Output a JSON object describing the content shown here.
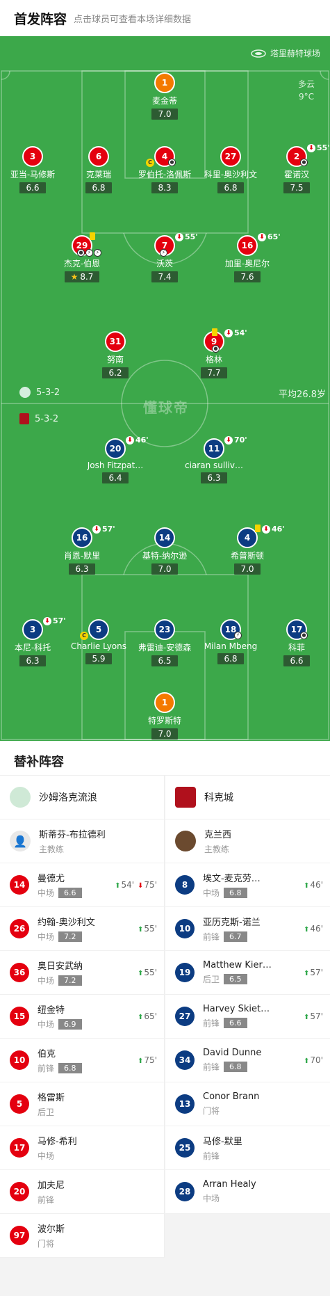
{
  "header": {
    "title": "首发阵容",
    "subtitle": "点击球员可查看本场详细数据"
  },
  "pitch": {
    "venue": "塔里赫特球场",
    "weather": "多云",
    "temperature": "9°C",
    "home_formation": "5-3-2",
    "away_formation": "5-3-2",
    "avg_age": "平均26.8岁",
    "watermark": "懂球帝"
  },
  "home_players": [
    {
      "num": "1",
      "name": "麦金蒂",
      "rating": "7.0",
      "color": "org"
    },
    {
      "num": "3",
      "name": "亚当-马修斯",
      "rating": "6.6",
      "color": "red"
    },
    {
      "num": "6",
      "name": "克莱瑞",
      "rating": "6.8",
      "color": "red"
    },
    {
      "num": "4",
      "name": "罗伯托-洛佩斯",
      "rating": "8.3",
      "color": "red"
    },
    {
      "num": "27",
      "name": "科里-奥沙利文",
      "rating": "6.8",
      "color": "red"
    },
    {
      "num": "2",
      "name": "霍诺汉",
      "rating": "7.5",
      "color": "red",
      "sub": "55'"
    },
    {
      "num": "29",
      "name": "杰克-伯恩",
      "rating": "8.7",
      "color": "red"
    },
    {
      "num": "7",
      "name": "沃茨",
      "rating": "7.4",
      "color": "red",
      "sub": "55'"
    },
    {
      "num": "16",
      "name": "加里-奥尼尔",
      "rating": "7.6",
      "color": "red",
      "sub": "65'"
    },
    {
      "num": "31",
      "name": "努南",
      "rating": "6.2",
      "color": "red"
    },
    {
      "num": "9",
      "name": "格林",
      "rating": "7.7",
      "color": "red",
      "sub": "54'"
    }
  ],
  "away_players": [
    {
      "num": "20",
      "name": "Josh Fitzpat…",
      "rating": "6.4",
      "color": "blue",
      "sub": "46'"
    },
    {
      "num": "11",
      "name": "ciaran sulliv…",
      "rating": "6.3",
      "color": "blue",
      "sub": "70'"
    },
    {
      "num": "16",
      "name": "肖恩-默里",
      "rating": "6.3",
      "color": "blue",
      "sub": "57'"
    },
    {
      "num": "14",
      "name": "基特-纳尔逊",
      "rating": "7.0",
      "color": "blue"
    },
    {
      "num": "4",
      "name": "希普斯顿",
      "rating": "7.0",
      "color": "blue",
      "sub": "46'"
    },
    {
      "num": "3",
      "name": "本尼-科托",
      "rating": "6.3",
      "color": "blue",
      "sub": "57'"
    },
    {
      "num": "5",
      "name": "Charlie Lyons",
      "rating": "5.9",
      "color": "blue"
    },
    {
      "num": "23",
      "name": "弗雷迪-安德森",
      "rating": "6.5",
      "color": "blue"
    },
    {
      "num": "18",
      "name": "Milan Mbeng",
      "rating": "6.8",
      "color": "blue"
    },
    {
      "num": "17",
      "name": "科菲",
      "rating": "6.6",
      "color": "blue"
    },
    {
      "num": "1",
      "name": "特罗斯特",
      "rating": "7.0",
      "color": "org"
    }
  ],
  "subs": {
    "title": "替补阵容",
    "home": {
      "team": "沙姆洛克流浪",
      "coach": {
        "name": "斯蒂芬-布拉德利",
        "role": "主教练"
      },
      "players": [
        {
          "num": "14",
          "name": "曼德尤",
          "pos": "中场",
          "rating": "6.6",
          "in": "54'",
          "out": "75'"
        },
        {
          "num": "26",
          "name": "约翰-奥沙利文",
          "pos": "中场",
          "rating": "7.2",
          "in": "55'"
        },
        {
          "num": "36",
          "name": "奥日安武纳",
          "pos": "中场",
          "rating": "7.2",
          "in": "55'"
        },
        {
          "num": "15",
          "name": "纽金特",
          "pos": "中场",
          "rating": "6.9",
          "in": "65'"
        },
        {
          "num": "10",
          "name": "伯克",
          "pos": "前锋",
          "rating": "6.8",
          "in": "75'"
        },
        {
          "num": "5",
          "name": "格雷斯",
          "pos": "后卫"
        },
        {
          "num": "17",
          "name": "马修-希利",
          "pos": "中场"
        },
        {
          "num": "20",
          "name": "加夫尼",
          "pos": "前锋"
        },
        {
          "num": "97",
          "name": "波尔斯",
          "pos": "门将"
        }
      ]
    },
    "away": {
      "team": "科克城",
      "coach": {
        "name": "克兰西",
        "role": "主教练"
      },
      "players": [
        {
          "num": "8",
          "name": "埃文-麦克劳…",
          "pos": "中场",
          "rating": "6.8",
          "in": "46'"
        },
        {
          "num": "10",
          "name": "亚历克斯-诺兰",
          "pos": "前锋",
          "rating": "6.7",
          "in": "46'"
        },
        {
          "num": "19",
          "name": "Matthew Kier…",
          "pos": "后卫",
          "rating": "6.5",
          "in": "57'"
        },
        {
          "num": "27",
          "name": "Harvey Skieters",
          "pos": "前锋",
          "rating": "6.6",
          "in": "57'"
        },
        {
          "num": "34",
          "name": "David Dunne",
          "pos": "前锋",
          "rating": "6.8",
          "in": "70'"
        },
        {
          "num": "13",
          "name": "Conor Brann",
          "pos": "门将"
        },
        {
          "num": "25",
          "name": "马修-默里",
          "pos": "前锋"
        },
        {
          "num": "28",
          "name": "Arran Healy",
          "pos": "中场"
        }
      ]
    }
  }
}
